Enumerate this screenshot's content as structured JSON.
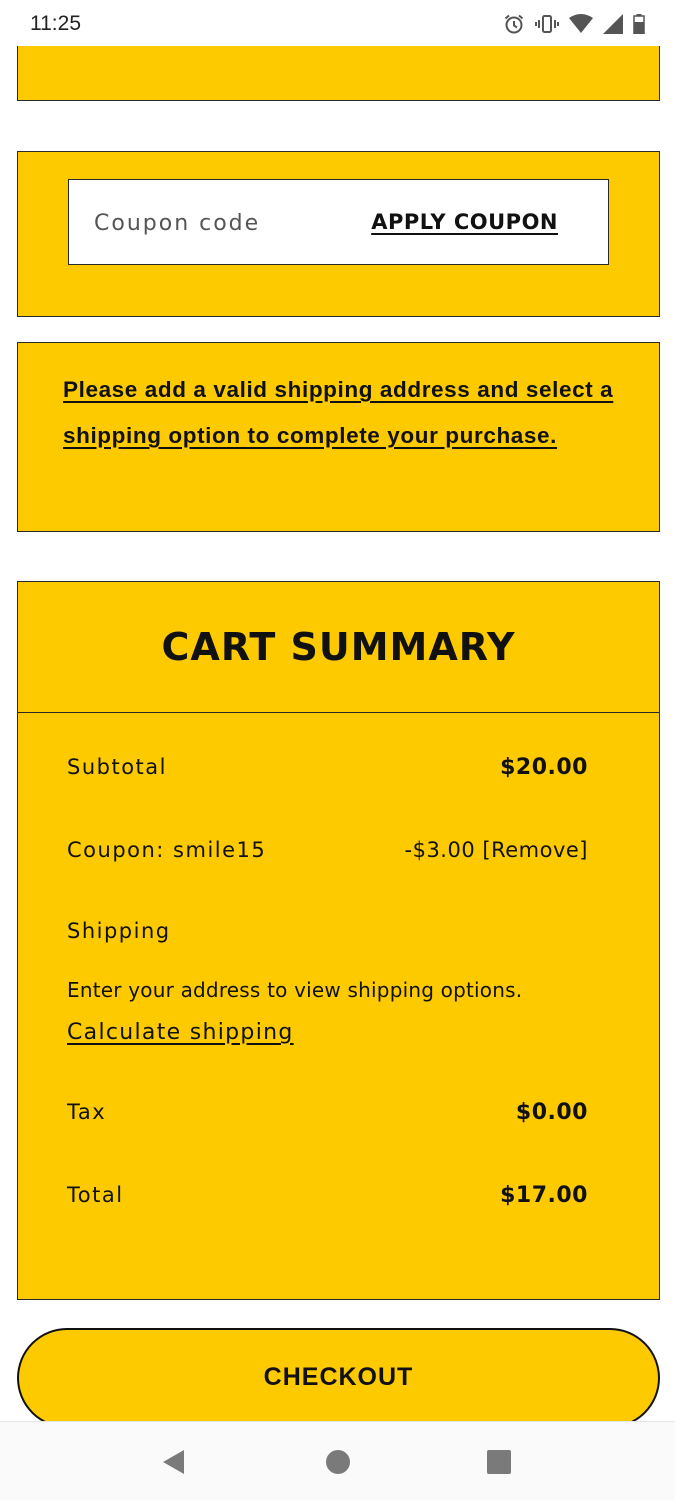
{
  "status_bar": {
    "time": "11:25",
    "icons": [
      "alarm-icon",
      "vibrate-icon",
      "wifi-icon",
      "signal-icon",
      "battery-icon"
    ]
  },
  "coupon": {
    "placeholder": "Coupon code",
    "apply_label": "APPLY COUPON"
  },
  "notice": {
    "text": "Please add a valid shipping address and select a shipping option to complete your purchase."
  },
  "cart_summary": {
    "title": "CART SUMMARY",
    "subtotal_label": "Subtotal",
    "subtotal_value": "$20.00",
    "coupon_label": "Coupon: smile15",
    "coupon_amount": "-$3.00",
    "coupon_remove": "[Remove]",
    "shipping_label": "Shipping",
    "shipping_description": "Enter your address to view shipping options.",
    "calculate_shipping": "Calculate shipping",
    "tax_label": "Tax",
    "tax_value": "$0.00",
    "total_label": "Total",
    "total_value": "$17.00"
  },
  "checkout": {
    "label": "CHECKOUT"
  },
  "nav_bar": {
    "buttons": [
      "back-icon",
      "home-icon",
      "recents-icon"
    ]
  },
  "colors": {
    "accent": "#fdca00",
    "border": "#2a2a2a",
    "text": "#111111"
  }
}
